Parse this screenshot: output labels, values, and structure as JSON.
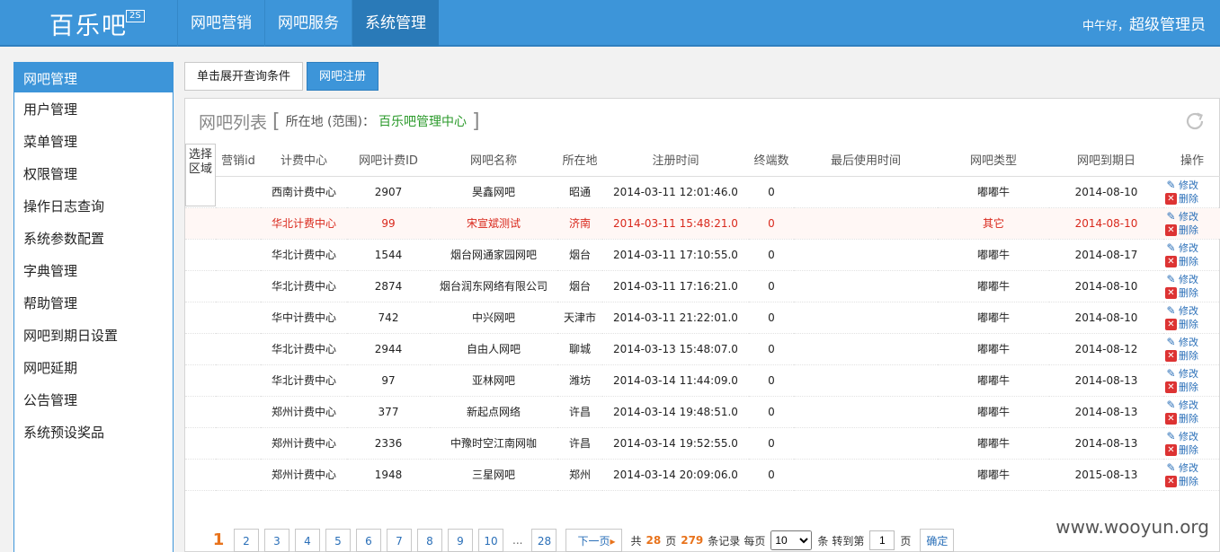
{
  "header": {
    "brand": "百乐吧",
    "badge": "2S",
    "nav": [
      {
        "label": "网吧营销",
        "active": false
      },
      {
        "label": "网吧服务",
        "active": false
      },
      {
        "label": "系统管理",
        "active": true
      }
    ],
    "greeting": "中午好，",
    "admin_name": "超级管理员"
  },
  "sidebar": {
    "items": [
      {
        "label": "网吧管理",
        "active": true
      },
      {
        "label": "用户管理"
      },
      {
        "label": "菜单管理"
      },
      {
        "label": "权限管理"
      },
      {
        "label": "操作日志查询"
      },
      {
        "label": "系统参数配置"
      },
      {
        "label": "字典管理"
      },
      {
        "label": "帮助管理"
      },
      {
        "label": "网吧到期日设置"
      },
      {
        "label": "网吧延期"
      },
      {
        "label": "公告管理"
      },
      {
        "label": "系统预设奖品"
      }
    ]
  },
  "toolbar": {
    "expand_label": "单击展开查询条件",
    "register_label": "网吧注册"
  },
  "panel": {
    "title": "网吧列表",
    "location_label": "所在地 (范围)：",
    "location_value": "百乐吧管理中心",
    "region_label": "选择区域"
  },
  "table": {
    "columns": [
      "营销id",
      "计费中心",
      "网吧计费ID",
      "网吧名称",
      "所在地",
      "注册时间",
      "终端数",
      "最后使用时间",
      "网吧类型",
      "网吧到期日",
      "操作"
    ],
    "rows": [
      {
        "mkt": "",
        "center": "西南计费中心",
        "id": "2907",
        "name": "昊鑫网吧",
        "loc": "昭通",
        "reg": "2014-03-11 12:01:46.0",
        "terms": "0",
        "last": "",
        "type": "嘟嘟牛",
        "expire": "2014-08-10",
        "highlight": false
      },
      {
        "mkt": "",
        "center": "华北计费中心",
        "id": "99",
        "name": "宋宣斌测试",
        "loc": "济南",
        "reg": "2014-03-11 15:48:21.0",
        "terms": "0",
        "last": "",
        "type": "其它",
        "expire": "2014-08-10",
        "highlight": true
      },
      {
        "mkt": "",
        "center": "华北计费中心",
        "id": "1544",
        "name": "烟台网通家园网吧",
        "loc": "烟台",
        "reg": "2014-03-11 17:10:55.0",
        "terms": "0",
        "last": "",
        "type": "嘟嘟牛",
        "expire": "2014-08-17",
        "highlight": false
      },
      {
        "mkt": "",
        "center": "华北计费中心",
        "id": "2874",
        "name": "烟台润东网络有限公司",
        "loc": "烟台",
        "reg": "2014-03-11 17:16:21.0",
        "terms": "0",
        "last": "",
        "type": "嘟嘟牛",
        "expire": "2014-08-10",
        "highlight": false
      },
      {
        "mkt": "",
        "center": "华中计费中心",
        "id": "742",
        "name": "中兴网吧",
        "loc": "天津市",
        "reg": "2014-03-11 21:22:01.0",
        "terms": "0",
        "last": "",
        "type": "嘟嘟牛",
        "expire": "2014-08-10",
        "highlight": false
      },
      {
        "mkt": "",
        "center": "华北计费中心",
        "id": "2944",
        "name": "自由人网吧",
        "loc": "聊城",
        "reg": "2014-03-13 15:48:07.0",
        "terms": "0",
        "last": "",
        "type": "嘟嘟牛",
        "expire": "2014-08-12",
        "highlight": false
      },
      {
        "mkt": "",
        "center": "华北计费中心",
        "id": "97",
        "name": "亚林网吧",
        "loc": "潍坊",
        "reg": "2014-03-14 11:44:09.0",
        "terms": "0",
        "last": "",
        "type": "嘟嘟牛",
        "expire": "2014-08-13",
        "highlight": false
      },
      {
        "mkt": "",
        "center": "郑州计费中心",
        "id": "377",
        "name": "新起点网络",
        "loc": "许昌",
        "reg": "2014-03-14 19:48:51.0",
        "terms": "0",
        "last": "",
        "type": "嘟嘟牛",
        "expire": "2014-08-13",
        "highlight": false
      },
      {
        "mkt": "",
        "center": "郑州计费中心",
        "id": "2336",
        "name": "中豫时空江南网咖",
        "loc": "许昌",
        "reg": "2014-03-14 19:52:55.0",
        "terms": "0",
        "last": "",
        "type": "嘟嘟牛",
        "expire": "2014-08-13",
        "highlight": false
      },
      {
        "mkt": "",
        "center": "郑州计费中心",
        "id": "1948",
        "name": "三星网吧",
        "loc": "郑州",
        "reg": "2014-03-14 20:09:06.0",
        "terms": "0",
        "last": "",
        "type": "嘟嘟牛",
        "expire": "2015-08-13",
        "highlight": false
      }
    ],
    "edit_label": "修改",
    "delete_label": "删除"
  },
  "pagination": {
    "current": "1",
    "pages": [
      "2",
      "3",
      "4",
      "5",
      "6",
      "7",
      "8",
      "9",
      "10"
    ],
    "ellipsis": "...",
    "last_page": "28",
    "next_label": "下一页",
    "total_prefix": "共",
    "total_pages": "28",
    "pages_suffix": "页",
    "total_records": "279",
    "records_suffix": "条记录",
    "per_page_prefix": "每页",
    "per_page_value": "10",
    "per_page_suffix": "条",
    "goto_prefix": "转到第",
    "goto_value": "1",
    "goto_suffix": "页",
    "confirm_label": "确定"
  },
  "watermark": "www.wooyun.org"
}
